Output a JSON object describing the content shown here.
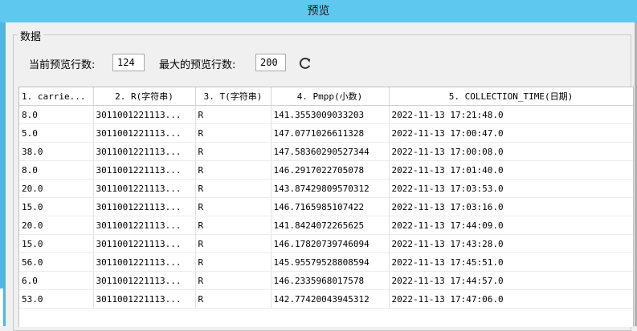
{
  "window": {
    "title": "预览"
  },
  "group": {
    "label": "数据"
  },
  "controls": {
    "current_rows_label": "当前预览行数:",
    "current_rows_value": "124",
    "max_rows_label": "最大的预览行数:",
    "max_rows_value": "200",
    "refresh_icon": "refresh-icon"
  },
  "table": {
    "columns": [
      "1. carrie...",
      "2. R(字符串)",
      "3. T(字符串)",
      "4. Pmpp(小数)",
      "5. COLLECTION_TIME(日期)"
    ],
    "rows": [
      [
        "8.0",
        "3011001221113...",
        "R",
        "141.3553009033203",
        "2022-11-13 17:21:48.0"
      ],
      [
        "5.0",
        "3011001221113...",
        "R",
        "147.0771026611328",
        "2022-11-13 17:00:47.0"
      ],
      [
        "38.0",
        "3011001221113...",
        "R",
        "147.58360290527344",
        "2022-11-13 17:00:08.0"
      ],
      [
        "8.0",
        "3011001221113...",
        "R",
        "146.2917022705078",
        "2022-11-13 17:01:40.0"
      ],
      [
        "20.0",
        "3011001221113...",
        "R",
        "143.87429809570312",
        "2022-11-13 17:03:53.0"
      ],
      [
        "15.0",
        "3011001221113...",
        "R",
        "146.7165985107422",
        "2022-11-13 17:03:16.0"
      ],
      [
        "20.0",
        "3011001221113...",
        "R",
        "141.8424072265625",
        "2022-11-13 17:44:09.0"
      ],
      [
        "15.0",
        "3011001221113...",
        "R",
        "146.17820739746094",
        "2022-11-13 17:43:28.0"
      ],
      [
        "56.0",
        "3011001221113...",
        "R",
        "145.95579528808594",
        "2022-11-13 17:45:51.0"
      ],
      [
        "6.0",
        "3011001221113...",
        "R",
        "146.2335968017578",
        "2022-11-13 17:44:57.0"
      ],
      [
        "53.0",
        "3011001221113...",
        "R",
        "142.77420043945312",
        "2022-11-13 17:47:06.0"
      ]
    ]
  }
}
